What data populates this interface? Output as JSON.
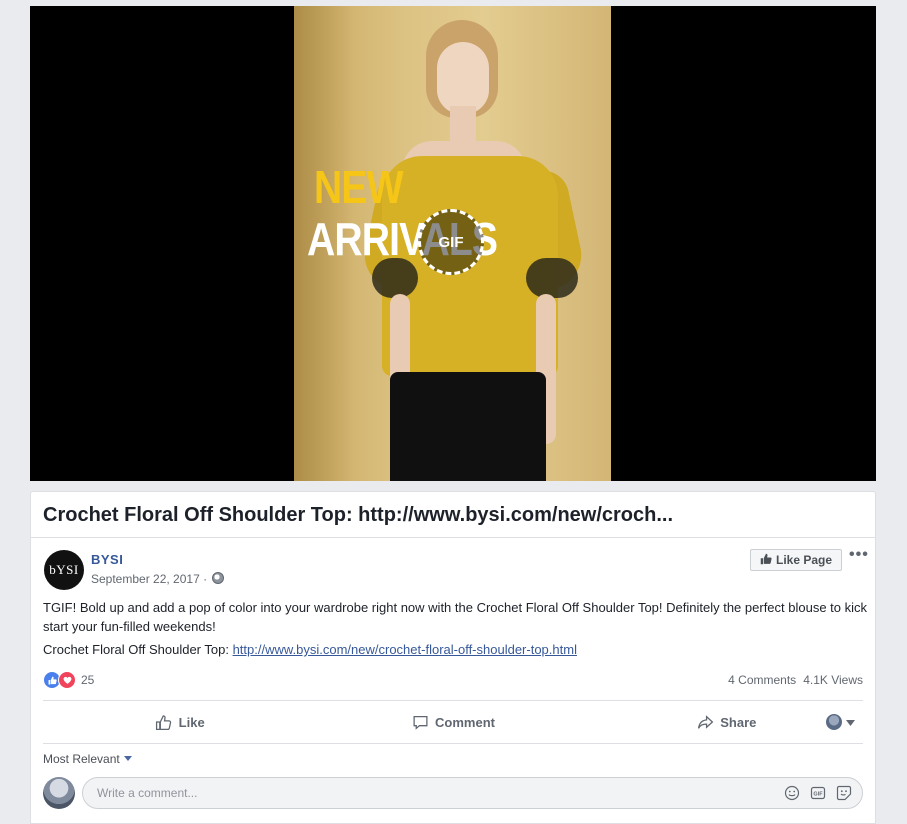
{
  "media": {
    "overlay_line1": "NEW",
    "overlay_line2": "ARRIVALS",
    "gif_badge": "GIF"
  },
  "post": {
    "title": "Crochet Floral Off Shoulder Top: http://www.bysi.com/new/croch...",
    "page_name": "BYSI",
    "avatar_text": "bYSI",
    "date": "September 22, 2017",
    "date_separator": " · ",
    "like_page_label": "Like Page",
    "body": "TGIF! Bold up and add a pop of color into your wardrobe right now with the Crochet Floral Off Shoulder Top! Definitely the perfect blouse to kick start your fun-filled weekends!",
    "link_prefix": "Crochet Floral Off Shoulder Top: ",
    "link_text": "http://www.bysi.com/new/crochet-floral-off-shoulder-top.html"
  },
  "reactions": {
    "count": "25",
    "comments": "4 Comments",
    "views": "4.1K Views"
  },
  "actions": {
    "like": "Like",
    "comment": "Comment",
    "share": "Share"
  },
  "comments": {
    "sort_label": "Most Relevant",
    "placeholder": "Write a comment..."
  },
  "colors": {
    "link": "#365899",
    "overlay_yellow": "#f5c518",
    "like_blue": "#4a80ec",
    "love_red": "#f0445c"
  },
  "icons": [
    "gif-badge-icon",
    "globe-icon",
    "like-page-thumb-icon",
    "more-icon",
    "like-reaction-icon",
    "love-reaction-icon",
    "like-icon",
    "comment-icon",
    "share-icon",
    "chevron-down-icon",
    "emoji-icon",
    "gif-icon",
    "sticker-icon"
  ]
}
